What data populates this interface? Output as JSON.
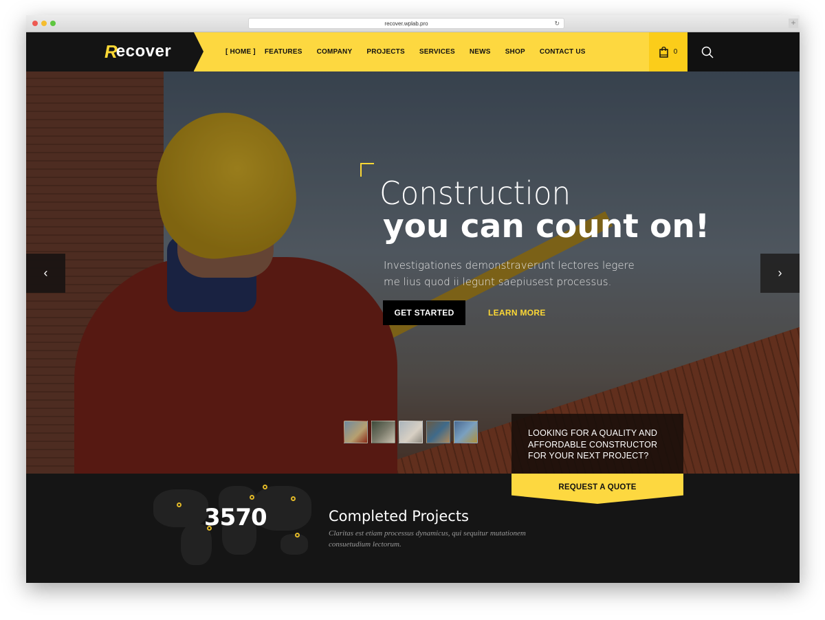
{
  "browser": {
    "url": "recover.wplab.pro"
  },
  "header": {
    "logo_mark": "R",
    "logo_text": "ecover",
    "nav": [
      {
        "label": "[ HOME ]",
        "active": true
      },
      {
        "label": "FEATURES"
      },
      {
        "label": "COMPANY"
      },
      {
        "label": "PROJECTS"
      },
      {
        "label": "SERVICES"
      },
      {
        "label": "NEWS"
      },
      {
        "label": "SHOP"
      },
      {
        "label": "CONTACT US"
      }
    ],
    "cart_count": "0"
  },
  "hero": {
    "title_light": "Construction",
    "title_bold": "you can count on!",
    "subtitle": "Investigationes demonstraverunt lectores legere me lius quod ii legunt saepiusest processus.",
    "primary_button": "GET STARTED",
    "secondary_button": "LEARN MORE",
    "prev_arrow": "‹",
    "next_arrow": "›",
    "thumbnail_count": 5
  },
  "quote": {
    "text_lines": [
      "LOOKING FOR A QUALITY AND",
      "AFFORDABLE CONSTRUCTOR",
      "FOR YOUR NEXT PROJECT?"
    ],
    "button": "REQUEST A QUOTE"
  },
  "stats": {
    "count": "3570",
    "title": "Completed Projects",
    "description": "Claritas est etiam processus dynamicus, qui sequitur mutationem consuetudium lectorum."
  },
  "colors": {
    "accent": "#fdd840",
    "dark": "#151515"
  }
}
